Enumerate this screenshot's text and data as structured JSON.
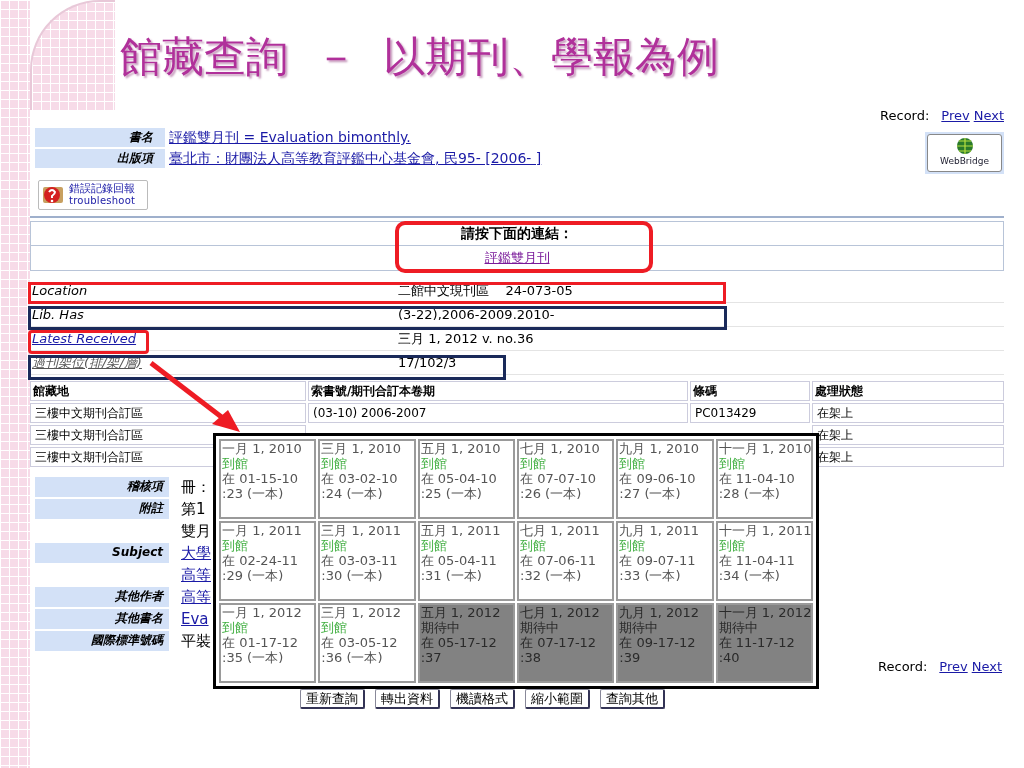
{
  "slide_title": "館藏查詢  －  以期刊、學報為例",
  "record_nav_top": {
    "label": "Record:",
    "prev": "Prev",
    "next": "Next"
  },
  "bib": [
    {
      "label": "書名",
      "value": "評鑑雙月刊 = Evaluation bimonthly."
    },
    {
      "label": "出版項",
      "value": "臺北市：財團法人高等教育評鑑中心基金會, 民95- [2006- ]"
    }
  ],
  "troubleshoot": {
    "line1": "錯誤記錄回報",
    "line2": "troubleshoot"
  },
  "webbridge": "WebBridge",
  "link_box": {
    "heading": "請按下面的連結：",
    "link": "評鑑雙月刊"
  },
  "holdings_info": [
    {
      "label": "Location",
      "value": "二館中文現刊區    24-073-05",
      "kind": "plain"
    },
    {
      "label": "Lib. Has",
      "value": "(3-22),2006-2009.2010-",
      "kind": "plain"
    },
    {
      "label": "Latest Received",
      "value": "三月 1, 2012 v. no.36",
      "kind": "link"
    },
    {
      "label": "過刊架位(排/架/層)",
      "value": "17/102/3",
      "kind": "underlined"
    }
  ],
  "holdings_table": {
    "columns": [
      "館藏地",
      "索書號/期刊合訂本卷期",
      "條碼",
      "處理狀態"
    ],
    "rows": [
      {
        "location": "三樓中文期刊合訂區",
        "call_number": "(03-10) 2006-2007",
        "barcode": "PC013429",
        "status": "在架上"
      },
      {
        "location": "三樓中文期刊合訂區",
        "status": "在架上"
      },
      {
        "location": "三樓中文期刊合訂區",
        "status": "在架上"
      }
    ]
  },
  "details": [
    {
      "label": "稽核項",
      "value": "冊：",
      "kind": "plain"
    },
    {
      "label": "附註",
      "value": "第1",
      "kind": "plain"
    },
    {
      "value": "雙月",
      "kind": "plain"
    },
    {
      "label": "Subject",
      "value": "大學",
      "kind": "link"
    },
    {
      "value": "高等",
      "kind": "link"
    },
    {
      "label": "其他作者",
      "value": "高等",
      "kind": "link"
    },
    {
      "label": "其他書名",
      "value": "Eva",
      "kind": "link"
    },
    {
      "label": "國際標準號碼",
      "value": "平裝",
      "kind": "plain"
    }
  ],
  "record_nav_bottom": {
    "label": "Record:",
    "prev": "Prev",
    "next": "Next"
  },
  "buttons": [
    "重新查詢",
    "轉出資料",
    "機讀格式",
    "縮小範圍",
    "查詢其他"
  ],
  "issues_popup": {
    "rows": [
      [
        {
          "date": "一月 1, 2010",
          "status": "到館",
          "arrival": "在 01-15-10",
          "issue": ":23 (一本)",
          "kind": "received"
        },
        {
          "date": "三月 1, 2010",
          "status": "到館",
          "arrival": "在 03-02-10",
          "issue": ":24 (一本)",
          "kind": "received"
        },
        {
          "date": "五月 1, 2010",
          "status": "到館",
          "arrival": "在 05-04-10",
          "issue": ":25 (一本)",
          "kind": "received"
        },
        {
          "date": "七月 1, 2010",
          "status": "到館",
          "arrival": "在 07-07-10",
          "issue": ":26 (一本)",
          "kind": "received"
        },
        {
          "date": "九月 1, 2010",
          "status": "到館",
          "arrival": "在 09-06-10",
          "issue": ":27 (一本)",
          "kind": "received"
        },
        {
          "date": "十一月 1, 2010",
          "status": "到館",
          "arrival": "在 11-04-10",
          "issue": ":28 (一本)",
          "kind": "received"
        }
      ],
      [
        {
          "date": "一月 1, 2011",
          "status": "到館",
          "arrival": "在 02-24-11",
          "issue": ":29 (一本)",
          "kind": "received"
        },
        {
          "date": "三月 1, 2011",
          "status": "到館",
          "arrival": "在 03-03-11",
          "issue": ":30 (一本)",
          "kind": "received"
        },
        {
          "date": "五月 1, 2011",
          "status": "到館",
          "arrival": "在 05-04-11",
          "issue": ":31 (一本)",
          "kind": "received"
        },
        {
          "date": "七月 1, 2011",
          "status": "到館",
          "arrival": "在 07-06-11",
          "issue": ":32 (一本)",
          "kind": "received"
        },
        {
          "date": "九月 1, 2011",
          "status": "到館",
          "arrival": "在 09-07-11",
          "issue": ":33 (一本)",
          "kind": "received"
        },
        {
          "date": "十一月 1, 2011",
          "status": "到館",
          "arrival": "在 11-04-11",
          "issue": ":34 (一本)",
          "kind": "received"
        }
      ],
      [
        {
          "date": "一月 1, 2012",
          "status": "到館",
          "arrival": "在 01-17-12",
          "issue": ":35 (一本)",
          "kind": "received"
        },
        {
          "date": "三月 1, 2012",
          "status": "到館",
          "arrival": "在 03-05-12",
          "issue": ":36 (一本)",
          "kind": "received"
        },
        {
          "date": "五月 1, 2012",
          "status": "期待中",
          "arrival": "在 05-17-12",
          "issue": ":37",
          "kind": "expected"
        },
        {
          "date": "七月 1, 2012",
          "status": "期待中",
          "arrival": "在 07-17-12",
          "issue": ":38",
          "kind": "expected"
        },
        {
          "date": "九月 1, 2012",
          "status": "期待中",
          "arrival": "在 09-17-12",
          "issue": ":39",
          "kind": "expected"
        },
        {
          "date": "十一月 1, 2012",
          "status": "期待中",
          "arrival": "在 11-17-12",
          "issue": ":40",
          "kind": "expected"
        }
      ]
    ]
  }
}
